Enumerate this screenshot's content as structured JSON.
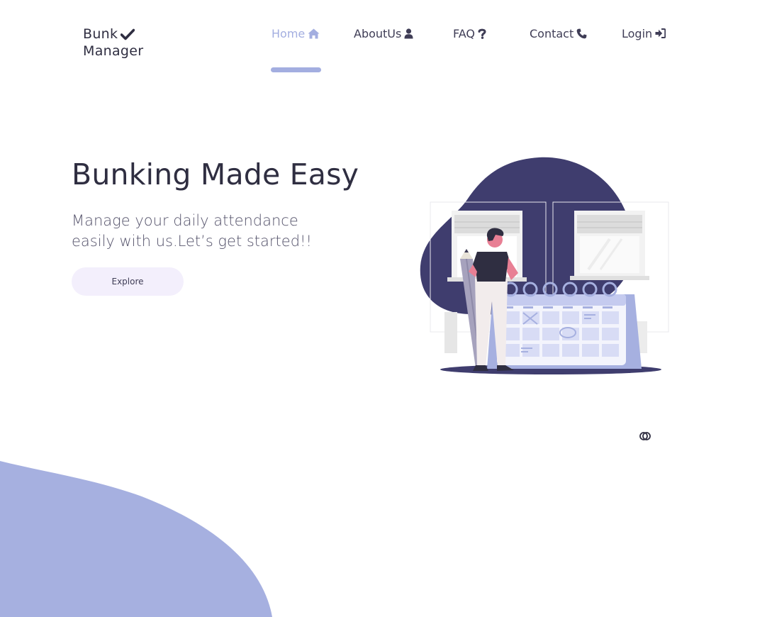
{
  "brand": {
    "line1": "Bunk",
    "line2": "Manager",
    "check_icon": "check-icon"
  },
  "nav": {
    "items": [
      {
        "label": "Home",
        "icon": "home-icon",
        "active": true
      },
      {
        "label": "AboutUs",
        "icon": "user-icon",
        "active": false
      },
      {
        "label": "FAQ",
        "icon": "question-icon",
        "active": false
      },
      {
        "label": "Contact",
        "icon": "phone-icon",
        "active": false
      },
      {
        "label": "Login",
        "icon": "sign-in-icon",
        "active": false
      }
    ]
  },
  "hero": {
    "title": "Bunking Made Easy",
    "subtitle_line1": "Manage your daily attendance",
    "subtitle_line2": "easily with us.Let’s get started!!",
    "cta_label": "Explore"
  },
  "colors": {
    "accent": "#a3aee0",
    "dark": "#3f3d56",
    "heading": "#2f2e41",
    "button_bg": "#f3effc",
    "blob": "#a6b0e0"
  }
}
